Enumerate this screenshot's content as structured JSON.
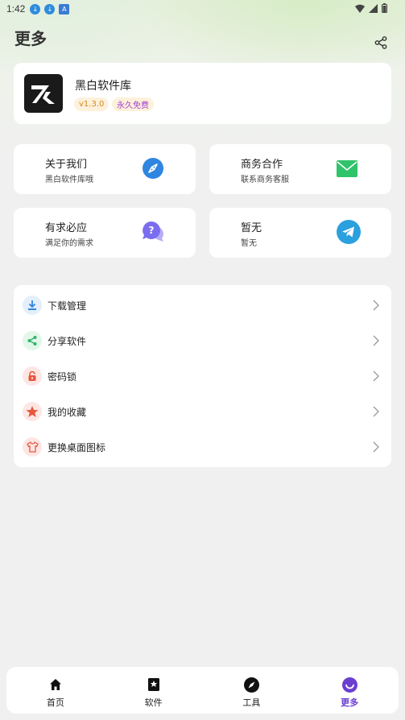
{
  "status": {
    "time": "1:42"
  },
  "header": {
    "title": "更多"
  },
  "profile": {
    "name": "黑白软件库",
    "version": "v1.3.0",
    "license": "永久免费"
  },
  "tiles": [
    {
      "title": "关于我们",
      "subtitle": "黑白软件库哦",
      "icon": "compass-icon",
      "color": "#2f86e0"
    },
    {
      "title": "商务合作",
      "subtitle": "联系商务客服",
      "icon": "mail-icon",
      "color": "#2fc36a"
    },
    {
      "title": "有求必应",
      "subtitle": "满足你的需求",
      "icon": "question-chat-icon",
      "color": "#7a6df0"
    },
    {
      "title": "暂无",
      "subtitle": "暂无",
      "icon": "telegram-icon",
      "color": "#2aa0de"
    }
  ],
  "menu": [
    {
      "label": "下载管理",
      "icon": "download-icon",
      "color": "#2f86e0"
    },
    {
      "label": "分享软件",
      "icon": "share-icon",
      "color": "#2fb56a"
    },
    {
      "label": "密码锁",
      "icon": "lock-icon",
      "color": "#e8553d"
    },
    {
      "label": "我的收藏",
      "icon": "star-icon",
      "color": "#e8553d"
    },
    {
      "label": "更换桌面图标",
      "icon": "shirt-icon",
      "color": "#e8553d"
    }
  ],
  "tabbar": [
    {
      "label": "首页",
      "icon": "home-icon",
      "active": false
    },
    {
      "label": "软件",
      "icon": "bookmark-star-icon",
      "active": false
    },
    {
      "label": "工具",
      "icon": "compass-icon",
      "active": false
    },
    {
      "label": "更多",
      "icon": "smile-icon",
      "active": true
    }
  ],
  "colors": {
    "accent": "#6b3fd0",
    "badge_bg": "#fdf1dc"
  }
}
